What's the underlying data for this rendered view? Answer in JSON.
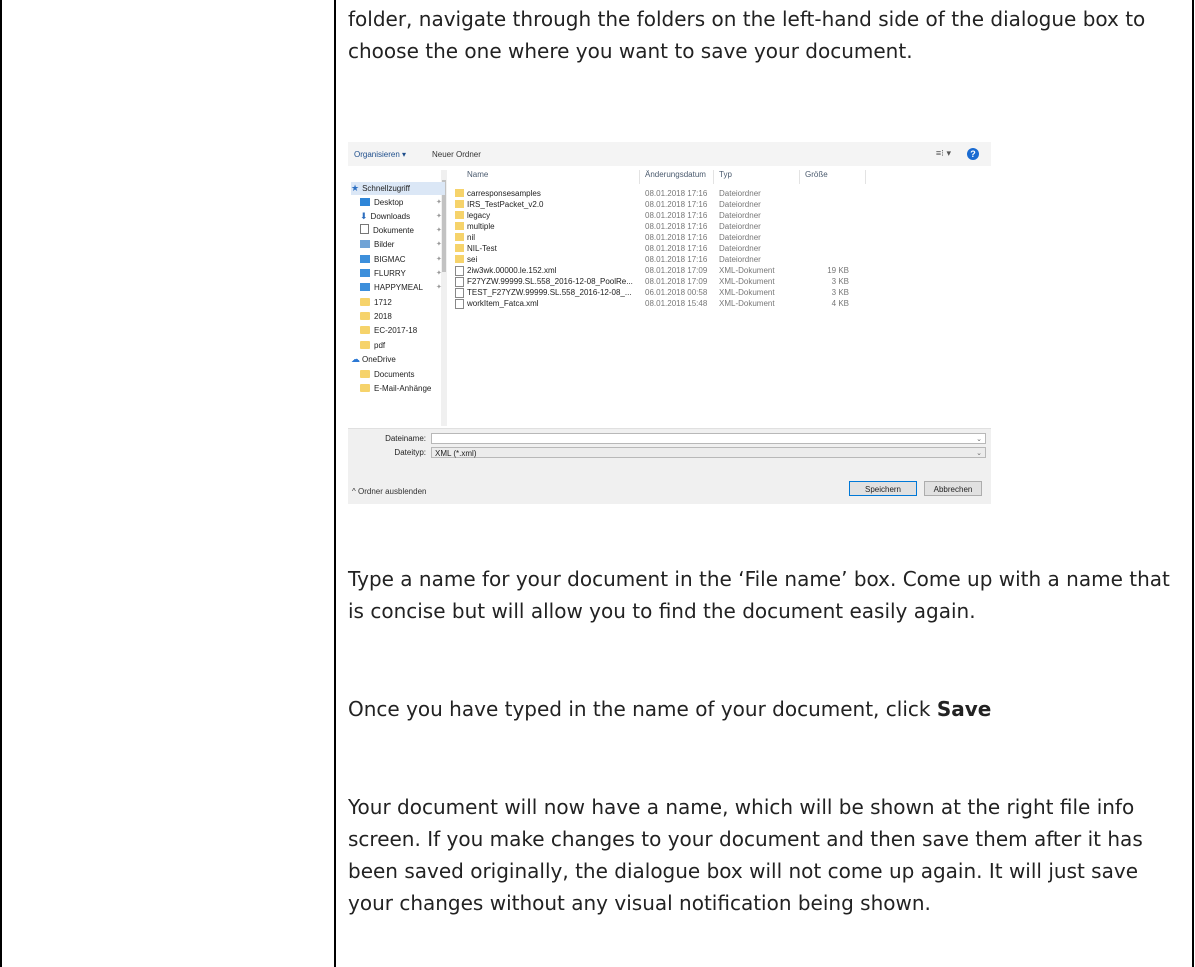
{
  "paragraphs": {
    "p1": "folder, navigate through the folders on the left-hand side of the dialogue box to choose the one where you want to save your document.",
    "p2": "Type a name for your document in the ‘File name’ box. Come up with a name that is concise but will allow you to find the document easily again.",
    "p3_prefix": "Once you have typed in the name of your document, click ",
    "p3_bold": "Save",
    "p4": "Your document will now have a name, which will be shown at the right file info screen. If you make changes to your document and then save them after it has been saved originally, the dialogue box will not come up again. It will just save your changes without any visual notification being shown."
  },
  "dialog": {
    "organize": "Organisieren ▾",
    "new_folder": "Neuer Ordner",
    "view_label": "≡⁝ ▾",
    "help": "?",
    "columns": {
      "name": "Name",
      "date": "Änderungsdatum",
      "type": "Typ",
      "size": "Größe"
    },
    "nav": [
      {
        "label": "Schnellzugriff",
        "icon": "star-icon"
      },
      {
        "label": "Desktop",
        "icon": "desktop-icon"
      },
      {
        "label": "Downloads",
        "icon": "download-icon"
      },
      {
        "label": "Dokumente",
        "icon": "document-icon"
      },
      {
        "label": "Bilder",
        "icon": "image-icon"
      },
      {
        "label": "BIGMAC",
        "icon": "computer-icon"
      },
      {
        "label": "FLURRY",
        "icon": "computer-icon"
      },
      {
        "label": "HAPPYMEAL",
        "icon": "computer-icon"
      },
      {
        "label": "1712",
        "icon": "folder-icon"
      },
      {
        "label": "2018",
        "icon": "folder-icon"
      },
      {
        "label": "EC-2017-18",
        "icon": "folder-icon"
      },
      {
        "label": "pdf",
        "icon": "folder-icon"
      },
      {
        "label": "OneDrive",
        "icon": "cloud-icon"
      },
      {
        "label": "Documents",
        "icon": "folder-icon"
      },
      {
        "label": "E-Mail-Anhänge",
        "icon": "folder-icon"
      }
    ],
    "files": [
      {
        "name": "carresponsesamples",
        "date": "08.01.2018 17:16",
        "type": "Dateiordner",
        "size": "",
        "kind": "folder"
      },
      {
        "name": "IRS_TestPacket_v2.0",
        "date": "08.01.2018 17:16",
        "type": "Dateiordner",
        "size": "",
        "kind": "folder"
      },
      {
        "name": "legacy",
        "date": "08.01.2018 17:16",
        "type": "Dateiordner",
        "size": "",
        "kind": "folder"
      },
      {
        "name": "multiple",
        "date": "08.01.2018 17:16",
        "type": "Dateiordner",
        "size": "",
        "kind": "folder"
      },
      {
        "name": "nil",
        "date": "08.01.2018 17:16",
        "type": "Dateiordner",
        "size": "",
        "kind": "folder"
      },
      {
        "name": "NIL-Test",
        "date": "08.01.2018 17:16",
        "type": "Dateiordner",
        "size": "",
        "kind": "folder"
      },
      {
        "name": "sei",
        "date": "08.01.2018 17:16",
        "type": "Dateiordner",
        "size": "",
        "kind": "folder"
      },
      {
        "name": "2iw3wk.00000.le.152.xml",
        "date": "08.01.2018 17:09",
        "type": "XML-Dokument",
        "size": "19 KB",
        "kind": "file"
      },
      {
        "name": "F27YZW.99999.SL.558_2016-12-08_PoolRe...",
        "date": "08.01.2018 17:09",
        "type": "XML-Dokument",
        "size": "3 KB",
        "kind": "file"
      },
      {
        "name": "TEST_F27YZW.99999.SL.558_2016-12-08_...",
        "date": "06.01.2018 00:58",
        "type": "XML-Dokument",
        "size": "3 KB",
        "kind": "file"
      },
      {
        "name": "workItem_Fatca.xml",
        "date": "08.01.2018 15:48",
        "type": "XML-Dokument",
        "size": "4 KB",
        "kind": "file"
      }
    ],
    "filename_label": "Dateiname:",
    "filename_value": "",
    "filetype_label": "Dateityp:",
    "filetype_value": "XML (*.xml)",
    "hide_folders": "^ Ordner ausblenden",
    "save_button": "Speichern",
    "cancel_button": "Abbrechen"
  }
}
